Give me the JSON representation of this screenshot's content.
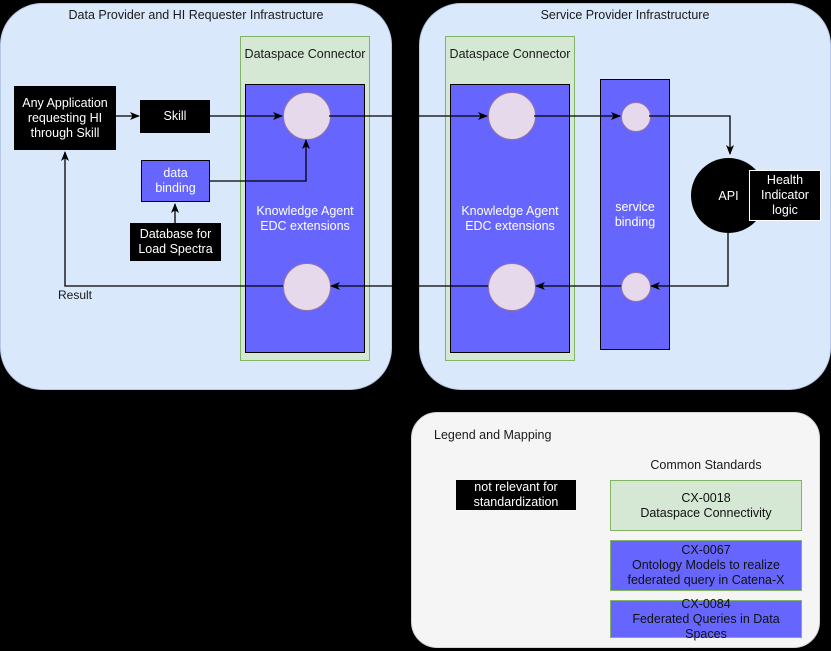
{
  "panels": {
    "left": {
      "title": "Data Provider and HI Requester Infrastructure"
    },
    "right": {
      "title": "Service Provider Infrastructure"
    }
  },
  "connectors": {
    "left": {
      "title": "Dataspace Connector"
    },
    "right": {
      "title": "Dataspace Connector"
    }
  },
  "nodes": {
    "any_application": "Any Application requesting HI through Skill",
    "skill": "Skill",
    "data_binding": "data binding",
    "database_load_spectra": "Database for Load Spectra",
    "knowledge_agent_left": "Knowledge Agent EDC extensions",
    "knowledge_agent_right": "Knowledge Agent EDC extensions",
    "service_binding": "service binding",
    "api": "API",
    "health_indicator_logic": "Health Indicator logic"
  },
  "edges": {
    "result_label": "Result"
  },
  "legend": {
    "title": "Legend and Mapping",
    "standards_heading": "Common Standards",
    "not_relevant": "not relevant for standardization",
    "items": [
      {
        "code": "CX-0018",
        "name": "Dataspace Connectivity",
        "color": "#d5e8d4"
      },
      {
        "code": "CX-0067",
        "name": "Ontology Models to realize federated query in Catena-X",
        "color": "#6666ff"
      },
      {
        "code": "CX-0084",
        "name": "Federated Queries in Data Spaces",
        "color": "#6666ff"
      }
    ]
  },
  "colors": {
    "infrastructure": "#dae8fc",
    "connector": "#d5e8d4",
    "component": "#6666ff",
    "not_relevant": "#000000",
    "port": "#e6d9ec",
    "legend_bg": "#f5f5f5"
  }
}
